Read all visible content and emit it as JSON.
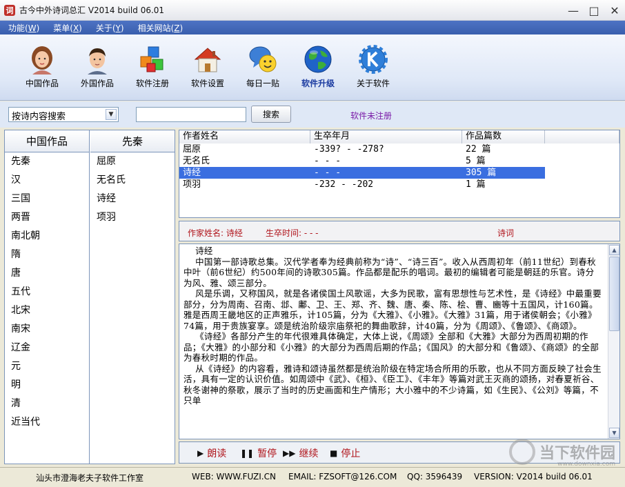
{
  "window": {
    "title": "古今中外诗词总汇 V2014 build 06.01",
    "minimize": "—",
    "maximize": "□",
    "close": "✕"
  },
  "menu": [
    {
      "label": "功能(",
      "key": "W",
      "tail": ")"
    },
    {
      "label": "菜单(",
      "key": "X",
      "tail": ")"
    },
    {
      "label": "关于(",
      "key": "Y",
      "tail": ")"
    },
    {
      "label": "相关网站(",
      "key": "Z",
      "tail": ")"
    }
  ],
  "toolbar": {
    "chinese_works": "中国作品",
    "foreign_works": "外国作品",
    "register": "软件注册",
    "settings": "软件设置",
    "daily_post": "每日一贴",
    "upgrade": "软件升级",
    "about": "关于软件"
  },
  "search": {
    "mode": "按诗内容搜索",
    "value": "",
    "button": "搜索",
    "status": "软件未注册"
  },
  "left": {
    "col1_header": "中国作品",
    "col2_header": "先秦",
    "dynasties": [
      "先秦",
      "汉",
      "三国",
      "两晋",
      "南北朝",
      "隋",
      "唐",
      "五代",
      "北宋",
      "南宋",
      "辽金",
      "元",
      "明",
      "清",
      "近当代"
    ],
    "authors": [
      "屈原",
      "无名氏",
      "诗经",
      "项羽"
    ]
  },
  "table": {
    "headers": [
      "作者姓名",
      "生卒年月",
      "作品篇数"
    ],
    "rows": [
      {
        "name": "屈原",
        "dates": "-339? - -278?",
        "count": "22 篇"
      },
      {
        "name": "无名氏",
        "dates": "- - -",
        "count": "5 篇"
      },
      {
        "name": "诗经",
        "dates": "- - -",
        "count": "305 篇"
      },
      {
        "name": "项羽",
        "dates": "-232 - -202",
        "count": "1 篇"
      }
    ]
  },
  "info": {
    "author_label": "作家姓名: 诗经",
    "dates_label": "生卒时间: - - -",
    "kind": "诗词"
  },
  "text": {
    "body": "    诗经\n    中国第一部诗歌总集。汉代学者奉为经典前称为“诗”、“诗三百”。收入从西周初年（前11世纪）到春秋中叶（前6世纪）约500年间的诗歌305篇。作品都是配乐的唱词。最初的编辑者可能是朝廷的乐官。诗分为风、雅、颂三部分。\n    风是乐调，又称国风，就是各诸侯国土风歌谣，大多为民歌，富有思想性与艺术性，是《诗经》中最重要部分，分为周南、召南、邶、鄘、卫、王、郑、齐、魏、唐、秦、陈、桧、曹、豳等十五国风，计160篇。雅是西周王畿地区的正声雅乐，计105篇，分为《大雅》、《小雅》。《大雅》31篇，用于诸侯朝会；《小雅》74篇，用于贵族宴享。颂是统治阶级宗庙祭祀的舞曲歌辞，计40篇，分为《周颂》、《鲁颂》、《商颂》。\n    《诗经》各部分产生的年代很难具体确定，大体上说，《周颂》全部和《大雅》大部分为西周初期的作品；《大雅》的小部分和《小雅》的大部分为西周后期的作品；《国风》的大部分和《鲁颂》、《商颂》的全部为春秋时期的作品。\n    从《诗经》的内容看，雅诗和颂诗虽然都是统治阶级在特定场合所用的乐歌，也从不同方面反映了社会生活，具有一定的认识价值。如周颂中《武》、《桓》、《臣工》、《丰年》等篇对武王灭商的颂扬，对春夏祈谷、秋冬谢神的祭歌，展示了当时的历史画面和生产情形；大小雅中的不少诗篇，如《生民》、《公刘》等篇，不只单"
  },
  "playback": {
    "read": "朗读",
    "pause": "暂停",
    "continue": "继续",
    "stop": "停止"
  },
  "status": {
    "studio": "汕头市澄海老夫子软件工作室",
    "web": "WEB: WWW.FUZI.CN",
    "email": "EMAIL: FZSOFT@126.COM",
    "qq": "QQ: 3596439",
    "version": "VERSION: V2014 build 06.01"
  },
  "watermark": {
    "text": "当下软件园",
    "url": "www.downxia.com"
  }
}
